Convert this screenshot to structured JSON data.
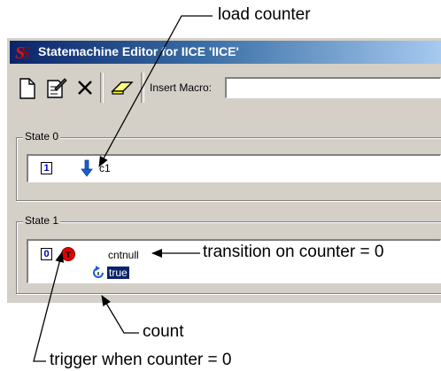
{
  "window": {
    "title": "Statemachine Editor for IICE 'IICE'"
  },
  "toolbar": {
    "insert_macro_label": "Insert Macro:",
    "insert_macro_value": ""
  },
  "states": [
    {
      "label": "State 0",
      "index": "1",
      "action": "c1"
    },
    {
      "label": "State 1",
      "index": "0",
      "transition": "cntnull",
      "condition": "true"
    }
  ],
  "callouts": {
    "load_counter": "load counter",
    "transition": "transition on counter = 0",
    "count": "count",
    "trigger": "trigger when counter = 0"
  },
  "colors": {
    "title_gradient_start": "#0a246a",
    "title_gradient_end": "#a6caf0",
    "window_face": "#d4d0c8",
    "selection": "#0a246a",
    "index_text": "#0000c0",
    "trigger_icon": "#e00000",
    "arrow_icon": "#1a5fd8"
  }
}
